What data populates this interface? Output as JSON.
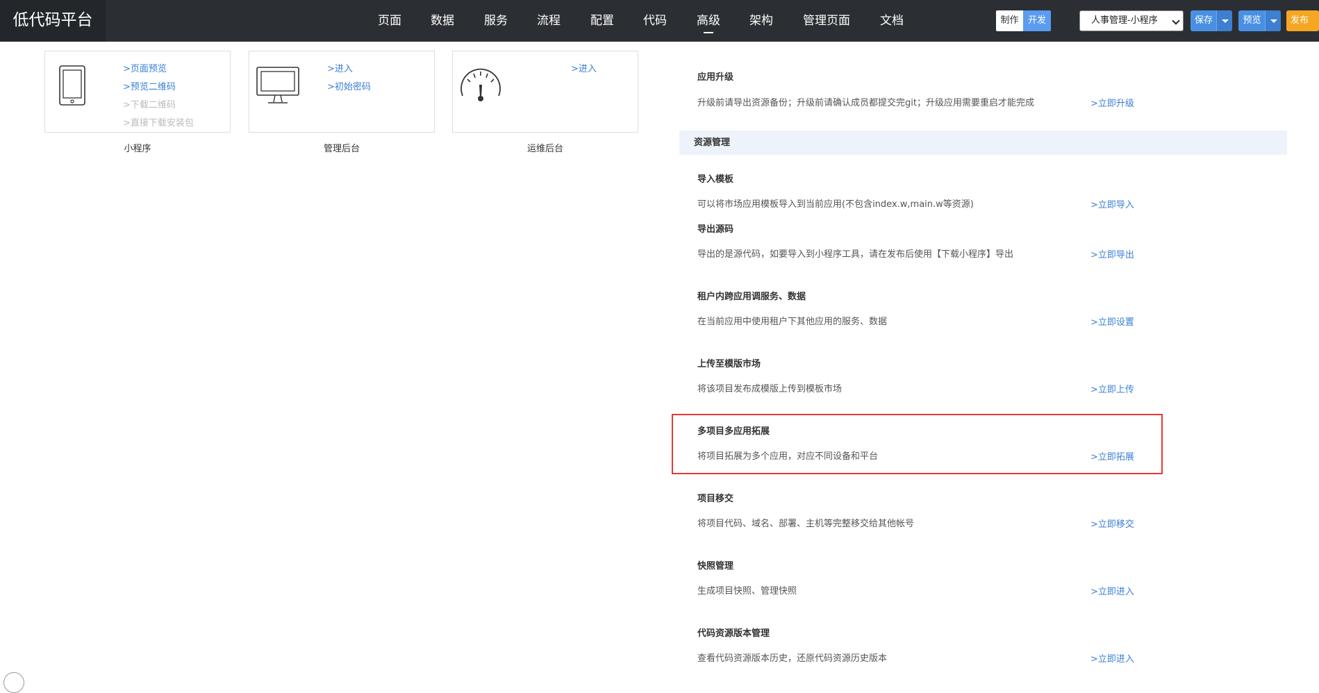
{
  "header": {
    "brand": "低代码平台",
    "nav": [
      "页面",
      "数据",
      "服务",
      "流程",
      "配置",
      "代码",
      "高级",
      "架构",
      "管理页面",
      "文档"
    ],
    "active_nav": "高级",
    "mode_make": "制作",
    "mode_dev": "开发",
    "app_select_value": "人事管理-小程序",
    "save_label": "保存",
    "preview_label": "预览",
    "publish_label": "发布"
  },
  "cards": [
    {
      "caption": "小程序",
      "links": [
        {
          "text": ">页面预览",
          "enabled": true
        },
        {
          "text": ">预览二维码",
          "enabled": true
        },
        {
          "text": ">下载二维码",
          "enabled": false
        },
        {
          "text": ">直接下载安装包",
          "enabled": false
        }
      ]
    },
    {
      "caption": "管理后台",
      "links": [
        {
          "text": ">进入",
          "enabled": true
        },
        {
          "text": ">初始密码",
          "enabled": true
        }
      ]
    },
    {
      "caption": "运维后台",
      "links": [
        {
          "text": ">进入",
          "enabled": true
        }
      ]
    }
  ],
  "upgrade": {
    "title": "应用升级",
    "desc": "升级前请导出资源备份；升级前请确认成员都提交完git；升级应用需要重启才能完成",
    "action": ">立即升级"
  },
  "resource_group": {
    "header": "资源管理",
    "items": [
      {
        "title": "导入模板",
        "desc": "可以将市场应用模板导入到当前应用(不包含index.w,main.w等资源)",
        "action": ">立即导入"
      },
      {
        "title": "导出源码",
        "desc": "导出的是源代码，如要导入到小程序工具，请在发布后使用【下载小程序】导出",
        "action": ">立即导出"
      },
      {
        "title": "租户内跨应用调服务、数据",
        "desc": "在当前应用中使用租户下其他应用的服务、数据",
        "action": ">立即设置"
      },
      {
        "title": "上传至模版市场",
        "desc": "将该项目发布成模版上传到模板市场",
        "action": ">立即上传"
      },
      {
        "title": "多项目多应用拓展",
        "desc": "将项目拓展为多个应用，对应不同设备和平台",
        "action": ">立即拓展"
      },
      {
        "title": "项目移交",
        "desc": "将项目代码、域名、部署、主机等完整移交给其他帐号",
        "action": ">立即移交"
      },
      {
        "title": "快照管理",
        "desc": "生成项目快照、管理快照",
        "action": ">立即进入"
      },
      {
        "title": "代码资源版本管理",
        "desc": "查看代码资源版本历史，还原代码资源历史版本",
        "action": ">立即进入"
      }
    ]
  },
  "colors": {
    "topbar": "#2b2f33",
    "link": "#3a7fd5",
    "highlight": "#e53935",
    "save_button": "#4a90e2",
    "publish_button": "#f5a623"
  }
}
